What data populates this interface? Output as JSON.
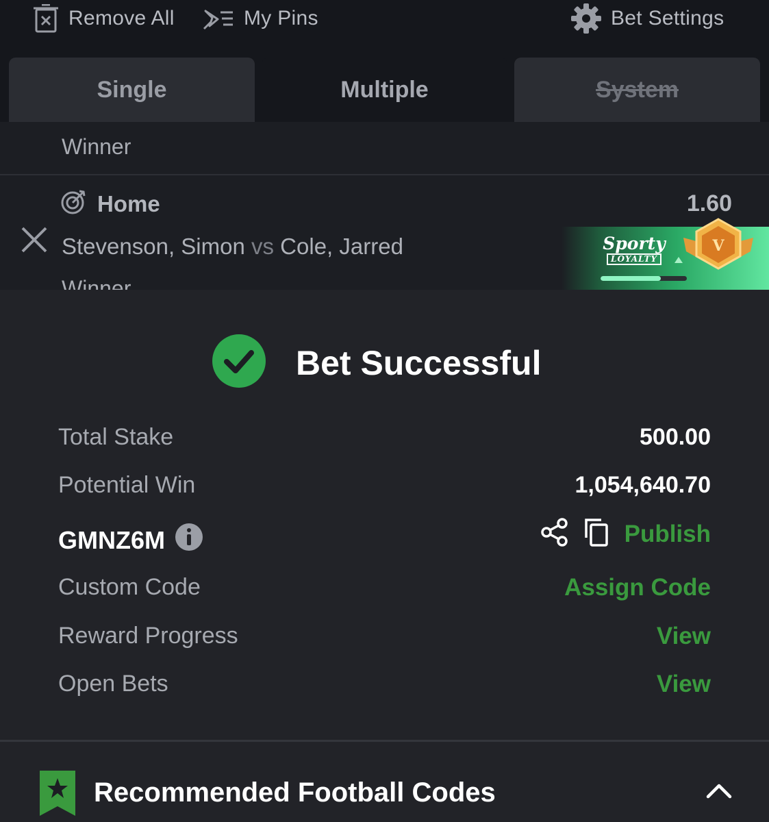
{
  "toolbar": {
    "remove_all": "Remove All",
    "my_pins": "My Pins",
    "bet_settings": "Bet Settings",
    "icons": [
      "trash-x-icon",
      "pin-list-icon",
      "gear-icon"
    ]
  },
  "tabs": {
    "single": "Single",
    "multiple": "Multiple",
    "system": "System"
  },
  "selection": {
    "prev_market": "Winner",
    "pick": "Home",
    "odds": "1.60",
    "home_player": "Stevenson, Simon",
    "vs": "vs",
    "away_player": "Cole, Jarred",
    "market": "Winner"
  },
  "loyalty": {
    "brand": "Sporty",
    "program": "LOYALTY",
    "tier": "V",
    "progress": 0.7
  },
  "result": {
    "title": "Bet Successful",
    "total_stake_label": "Total Stake",
    "total_stake": "500.00",
    "potential_win_label": "Potential Win",
    "potential_win": "1,054,640.70",
    "booking_code": "GMNZ6M",
    "publish": "Publish",
    "custom_code_label": "Custom Code",
    "assign_code": "Assign Code",
    "reward_progress_label": "Reward Progress",
    "reward_view": "View",
    "open_bets_label": "Open Bets",
    "open_bets_view": "View"
  },
  "recommended": {
    "title": "Recommended Football Codes"
  },
  "colors": {
    "accent_green": "#3a9a3e",
    "success_green": "#2fa84f",
    "background": "#222328"
  }
}
